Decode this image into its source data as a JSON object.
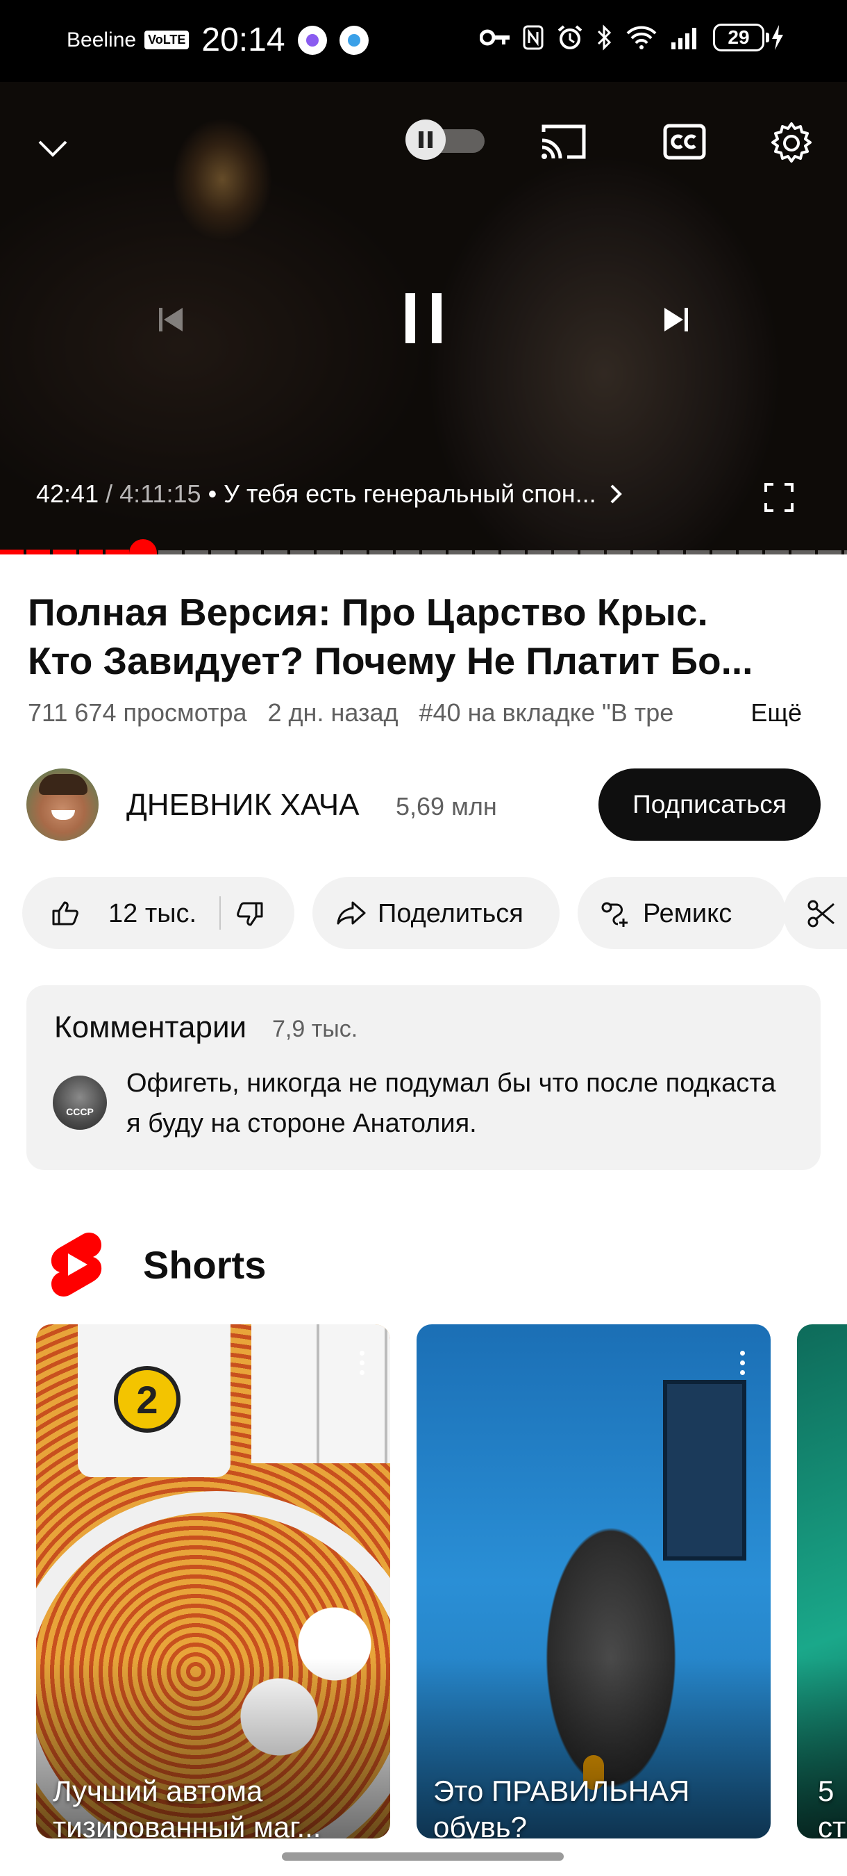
{
  "status_bar": {
    "carrier": "Beeline",
    "volte": "VoLTE",
    "time": "20:14",
    "battery": "29"
  },
  "player": {
    "current_time": "42:41",
    "separator": "/",
    "duration": "4:11:15",
    "chapter": "• У тебя есть генеральный спон...",
    "progress_fraction": 0.169,
    "buffered_fraction": 0.17,
    "autoplay_on": true,
    "accent_color": "#ff0000"
  },
  "video": {
    "title_line1": "Полная Версия: Про Царство Крыс.",
    "title_line2": "Кто Завидует? Почему Не Платит Бо...",
    "views": "711 674 просмотра",
    "age": "2 дн. назад",
    "trending": "#40 на вкладке \"В тре",
    "more": "Ещё"
  },
  "channel": {
    "name": "ДНЕВНИК ХАЧА",
    "subscribers": "5,69 млн",
    "subscribe_label": "Подписаться"
  },
  "actions": {
    "likes": "12 тыс.",
    "share": "Поделиться",
    "remix": "Ремикс"
  },
  "comments": {
    "title": "Комментарии",
    "count": "7,9 тыс.",
    "top_avatar_text": "СССР",
    "top_comment": "Офигеть, никогда не подумал бы что после подкаста я буду на стороне Анатолия."
  },
  "shorts": {
    "section_title": "Shorts",
    "items": [
      {
        "caption_line1": "Лучший автома",
        "caption_line2": "тизированный маг...",
        "badge": "2"
      },
      {
        "caption_line1": "Это ПРАВИЛЬНАЯ",
        "caption_line2": "обувь?"
      },
      {
        "caption_line1": "5",
        "caption_line2": "ст"
      }
    ]
  },
  "icons": {
    "collapse": "chevron-down-icon",
    "cast": "cast-icon",
    "captions": "cc-icon",
    "settings": "gear-icon",
    "previous": "skip-previous-icon",
    "pause": "pause-icon",
    "next": "skip-next-icon",
    "fullscreen": "fullscreen-icon"
  }
}
